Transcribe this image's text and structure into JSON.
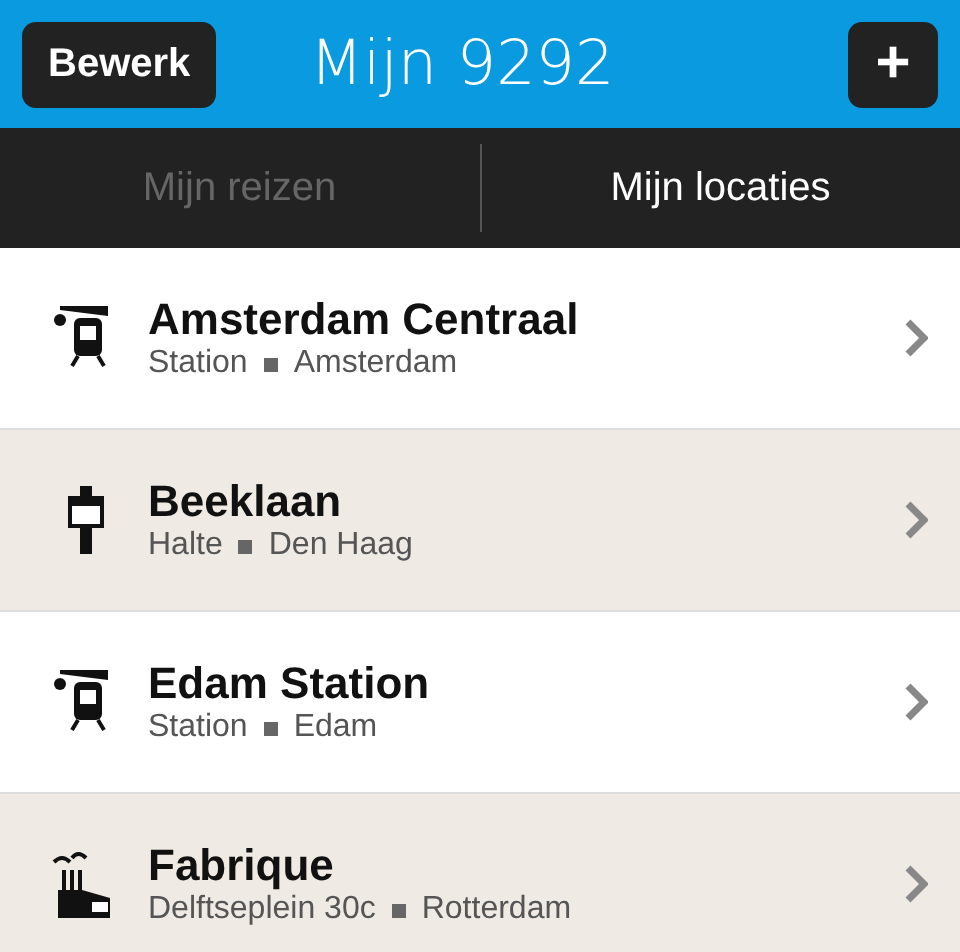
{
  "header": {
    "edit_button": "Bewerk",
    "title": "Mijn 9292",
    "add_button": "+"
  },
  "tabs": [
    {
      "label": "Mijn reizen",
      "selected": false
    },
    {
      "label": "Mijn locaties",
      "selected": true
    }
  ],
  "locations": [
    {
      "kind": "station",
      "name": "Amsterdam Centraal",
      "type": "Station",
      "place": "Amsterdam"
    },
    {
      "kind": "stop",
      "name": "Beeklaan",
      "type": "Halte",
      "place": "Den Haag"
    },
    {
      "kind": "station",
      "name": "Edam Station",
      "type": "Station",
      "place": "Edam"
    },
    {
      "kind": "factory",
      "name": "Fabrique",
      "type": "Delftseplein 30c",
      "place": "Rotterdam"
    }
  ]
}
